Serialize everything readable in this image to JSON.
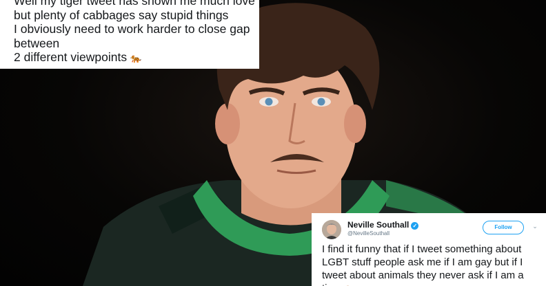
{
  "top_tweet": {
    "lines": [
      "Well my tiger tweet has shown me much love",
      "but plenty of cabbages say stupid things",
      "I obviously need to work harder to close gap",
      "between",
      "2 different viewpoints"
    ],
    "emoji": "🐅"
  },
  "embedded_tweet": {
    "name": "Neville Southall",
    "handle": "@NevilleSouthall",
    "follow_label": "Follow",
    "body": "I find it funny that if I tweet something about LGBT stuff people ask me if I am gay but if I tweet about animals they never ask if I am a tiger",
    "emoji": "🐅",
    "verified_color": "#1da1f2"
  },
  "icons": [
    "tiger-emoji-icon",
    "verified-badge-icon",
    "chevron-down-icon",
    "avatar"
  ]
}
